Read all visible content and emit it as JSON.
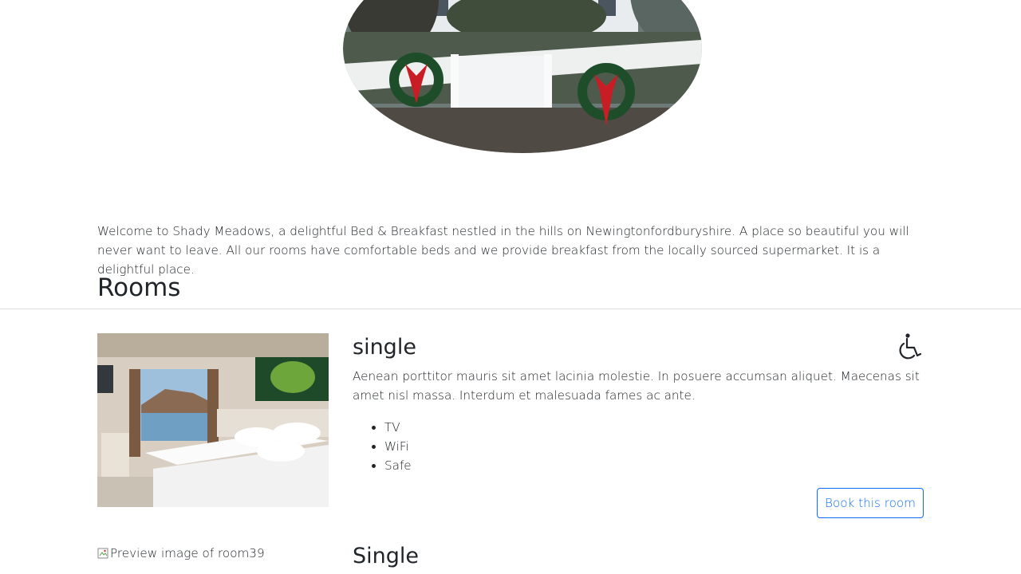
{
  "hero": {
    "image_description": ""
  },
  "welcome_text": "Welcome to Shady Meadows, a delightful Bed & Breakfast nestled in the hills on Newingtonfordburyshire. A place so beautiful you will never want to leave. All our rooms have comfortable beds and we provide breakfast from the locally sourced supermarket. It is a delightful place.",
  "rooms_heading": "Rooms",
  "rooms": [
    {
      "name": "single",
      "accessible_icon": "wheelchair-icon",
      "description": "Aenean porttitor mauris sit amet lacinia molestie. In posuere accumsan aliquet. Maecenas sit amet nisl massa. Interdum et malesuada fames ac ante.",
      "features": [
        "TV",
        "WiFi",
        "Safe"
      ],
      "book_label": "Book this room"
    },
    {
      "name": "Single",
      "image_alt": "Preview image of room39"
    }
  ],
  "colors": {
    "accent": "#0d6efd",
    "text": "#212529",
    "divider": "#dee2e6"
  }
}
